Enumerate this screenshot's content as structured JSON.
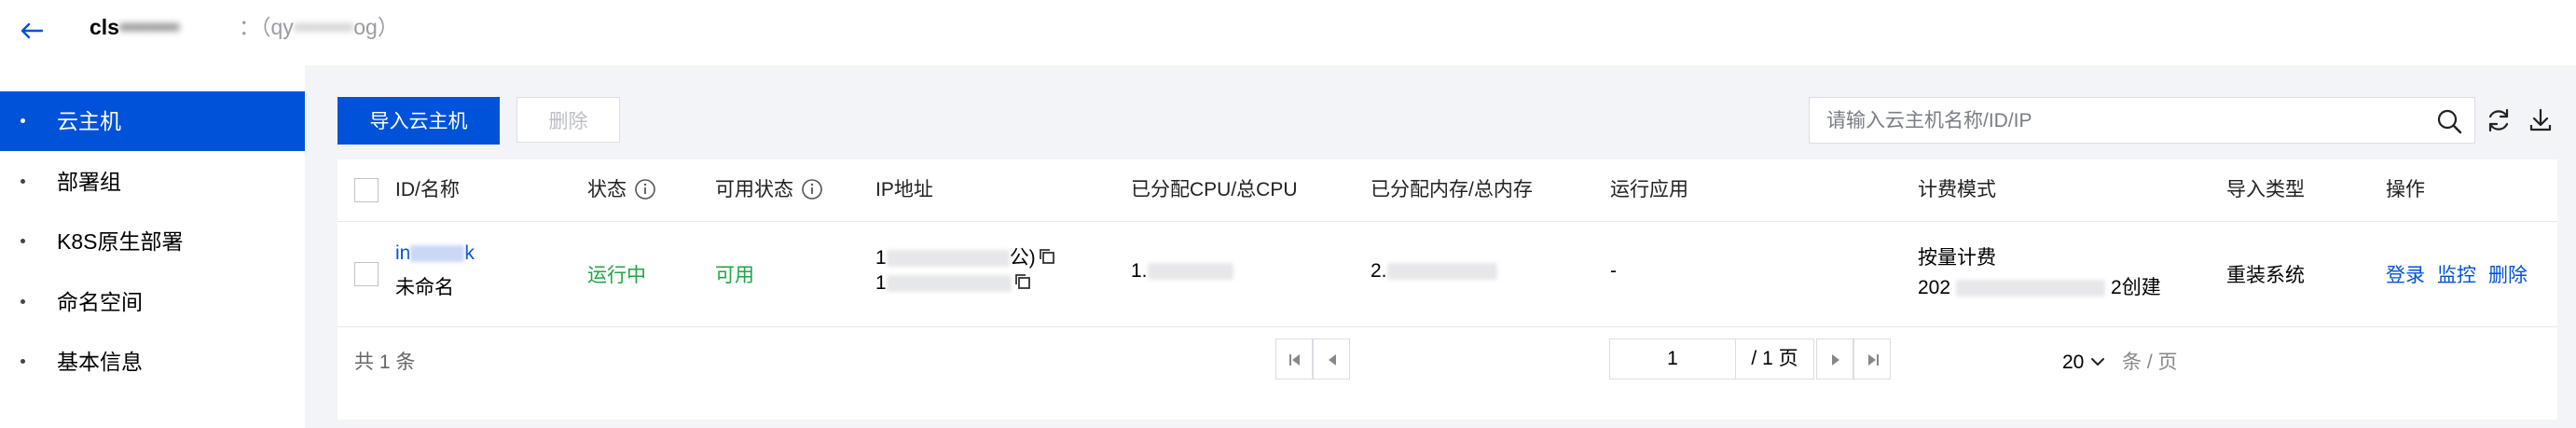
{
  "header": {
    "title_prefix": "cls",
    "title_suffix": "：（qy",
    "title_end": "og）"
  },
  "sidebar": {
    "items": [
      {
        "label": "云主机",
        "active": true
      },
      {
        "label": "部署组"
      },
      {
        "label": "K8S原生部署"
      },
      {
        "label": "命名空间"
      },
      {
        "label": "基本信息"
      }
    ]
  },
  "toolbar": {
    "import_label": "导入云主机",
    "delete_label": "删除",
    "search_placeholder": "请输入云主机名称/ID/IP"
  },
  "table": {
    "columns": [
      "ID/名称",
      "状态",
      "可用状态",
      "IP地址",
      "已分配CPU/总CPU",
      "已分配内存/总内存",
      "运行应用",
      "计费模式",
      "导入类型",
      "操作"
    ],
    "rows": [
      {
        "id_prefix": "in",
        "id_suffix": "k",
        "name": "未命名",
        "status": "运行中",
        "availability": "可用",
        "ip_public_prefix": "1",
        "ip_public_suffix": "公)",
        "ip_private_prefix": "1",
        "cpu_prefix": "1.",
        "mem_prefix": "2.",
        "running_app": "-",
        "billing_mode": "按量计费",
        "billing_date_prefix": "202",
        "billing_date_suffix": "2创建",
        "import_type": "重装系统",
        "actions": [
          "登录",
          "监控",
          "删除"
        ]
      }
    ]
  },
  "footer": {
    "total": "共 1 条",
    "page_size": "20",
    "per_page_unit": "条 / 页",
    "current_page": "1",
    "total_pages": "/ 1 页"
  }
}
